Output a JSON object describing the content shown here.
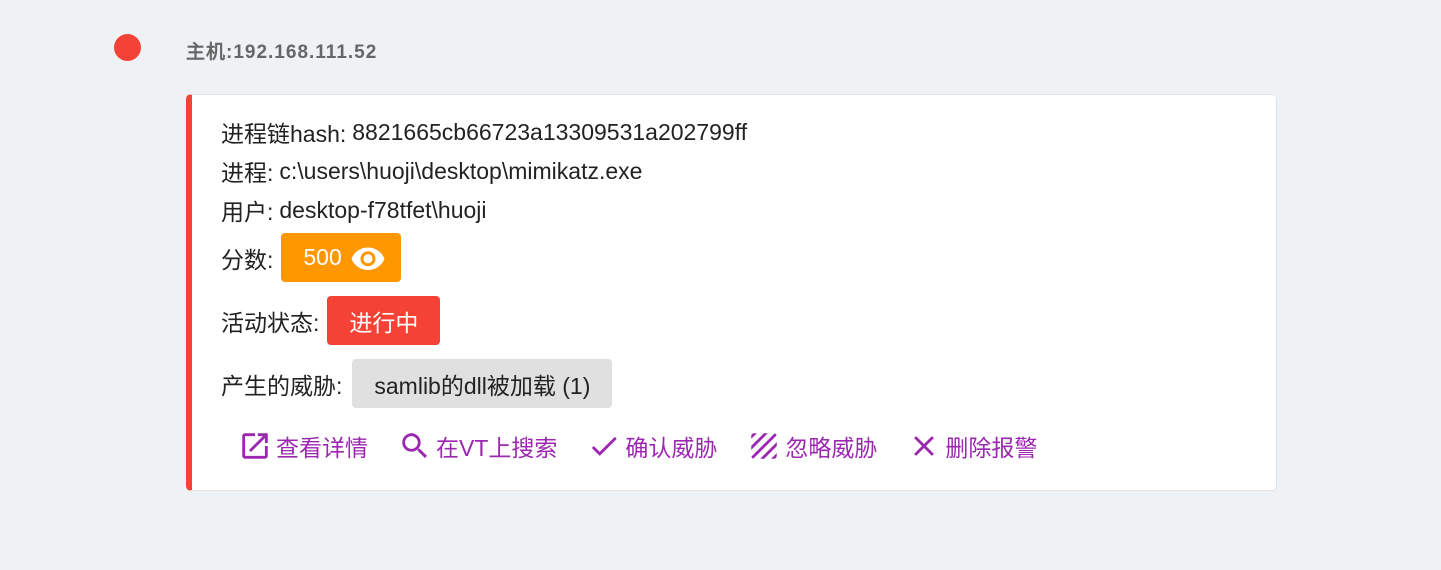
{
  "host": {
    "label": "主机:192.168.111.52",
    "status_color": "#f44336"
  },
  "alert": {
    "hash_label": "进程链hash:",
    "hash_value": "8821665cb66723a13309531a202799ff",
    "process_label": "进程:",
    "process_value": "c:\\users\\huoji\\desktop\\mimikatz.exe",
    "user_label": "用户:",
    "user_value": "desktop-f78tfet\\huoji",
    "score_label": "分数:",
    "score_value": "500",
    "score_icon": "eye-icon",
    "state_label": "活动状态:",
    "state_value": "进行中",
    "threat_label": "产生的威胁:",
    "threat_value": "samlib的dll被加载 (1)"
  },
  "actions": {
    "view_details": "查看详情",
    "search_vt": "在VT上搜索",
    "confirm_threat": "确认威胁",
    "ignore_threat": "忽略威胁",
    "delete_alert": "删除报警"
  },
  "colors": {
    "accent": "#9c27b0",
    "danger": "#f44336",
    "warning": "#ff9800",
    "chip": "#e0e0e0"
  }
}
